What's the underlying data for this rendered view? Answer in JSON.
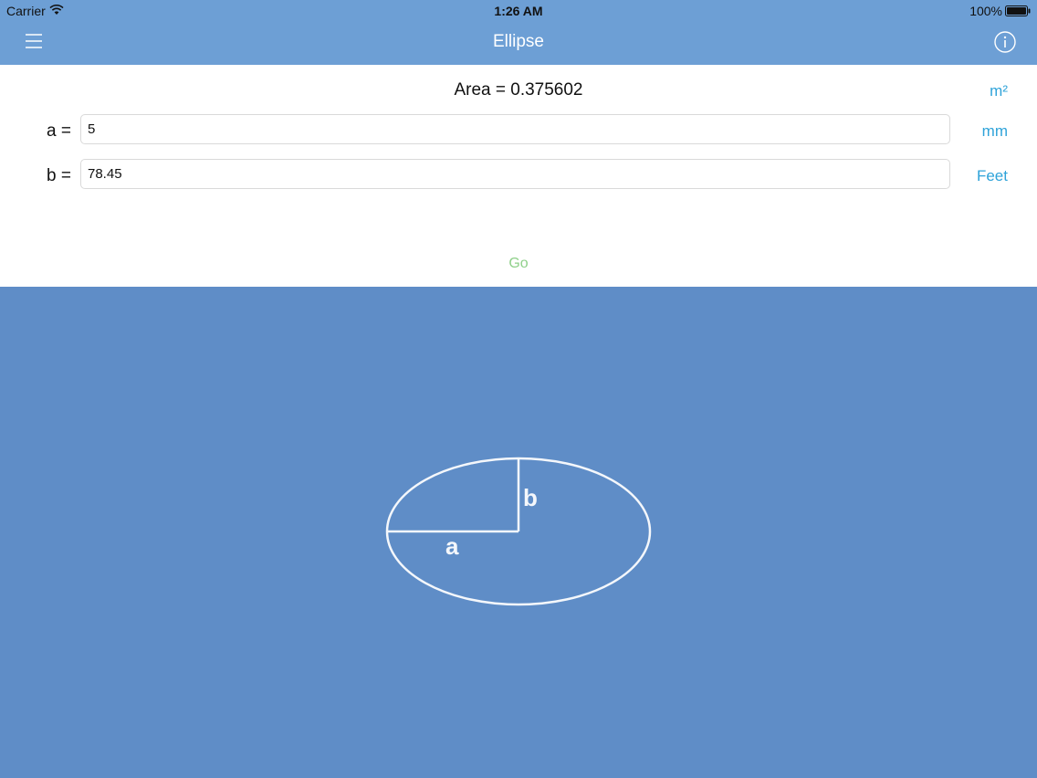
{
  "status": {
    "carrier": "Carrier",
    "time": "1:26 AM",
    "battery": "100%"
  },
  "nav": {
    "title": "Ellipse",
    "menu_icon": "hamburger-menu-icon",
    "info_icon": "info-icon"
  },
  "form": {
    "area_label": "Area = 0.375602",
    "area_unit": "m²",
    "a_label": "a =",
    "a_value": "5",
    "a_unit": "mm",
    "b_label": "b =",
    "b_value": "78.45",
    "b_unit": "Feet",
    "go_label": "Go"
  },
  "diagram": {
    "label_a": "a",
    "label_b": "b"
  },
  "colors": {
    "nav_bg": "#6d9fd5",
    "canvas_bg": "#5f8dc7",
    "unit_accent": "#2fa3d9",
    "go_green": "#8fd08a"
  }
}
